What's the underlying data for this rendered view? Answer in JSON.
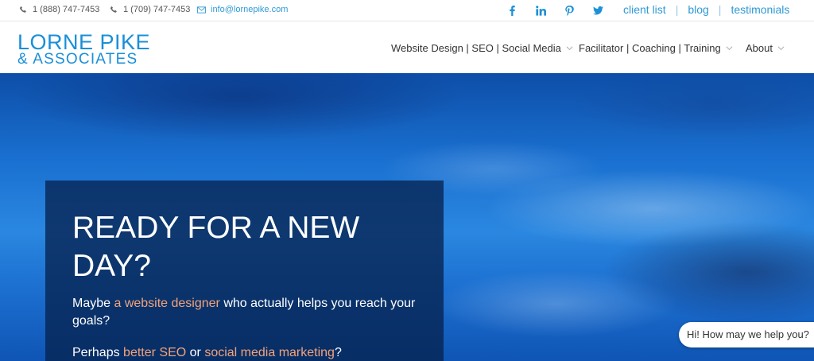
{
  "topbar": {
    "phone1": "1 (888) 747-7453",
    "phone2": "1 (709) 747-7453",
    "email": "info@lornepike.com",
    "social_icons": [
      "facebook-icon",
      "linkedin-icon",
      "pinterest-icon",
      "twitter-icon"
    ],
    "links": [
      "client list",
      "blog",
      "testimonials"
    ]
  },
  "logo": {
    "line1": "LORNE PIKE",
    "line2": "& ASSOCIATES"
  },
  "nav": [
    {
      "label": "Website Design | SEO | Social Media"
    },
    {
      "label": "Facilitator | Coaching | Training"
    },
    {
      "label": "About"
    }
  ],
  "hero": {
    "heading": "READY FOR A NEW DAY?",
    "p1_pre": "Maybe ",
    "p1_link": "a website designer",
    "p1_post": " who actually helps you reach your goals?",
    "p2_pre": "Perhaps ",
    "p2_link1": "better SEO",
    "p2_mid": " or ",
    "p2_link2": "social media marketing",
    "p2_post": "?"
  },
  "chat": {
    "text": "Hi! How may we help you?"
  },
  "colors": {
    "accent": "#1a8fd8",
    "link_highlight": "#f2a47a",
    "panel": "#062350"
  }
}
